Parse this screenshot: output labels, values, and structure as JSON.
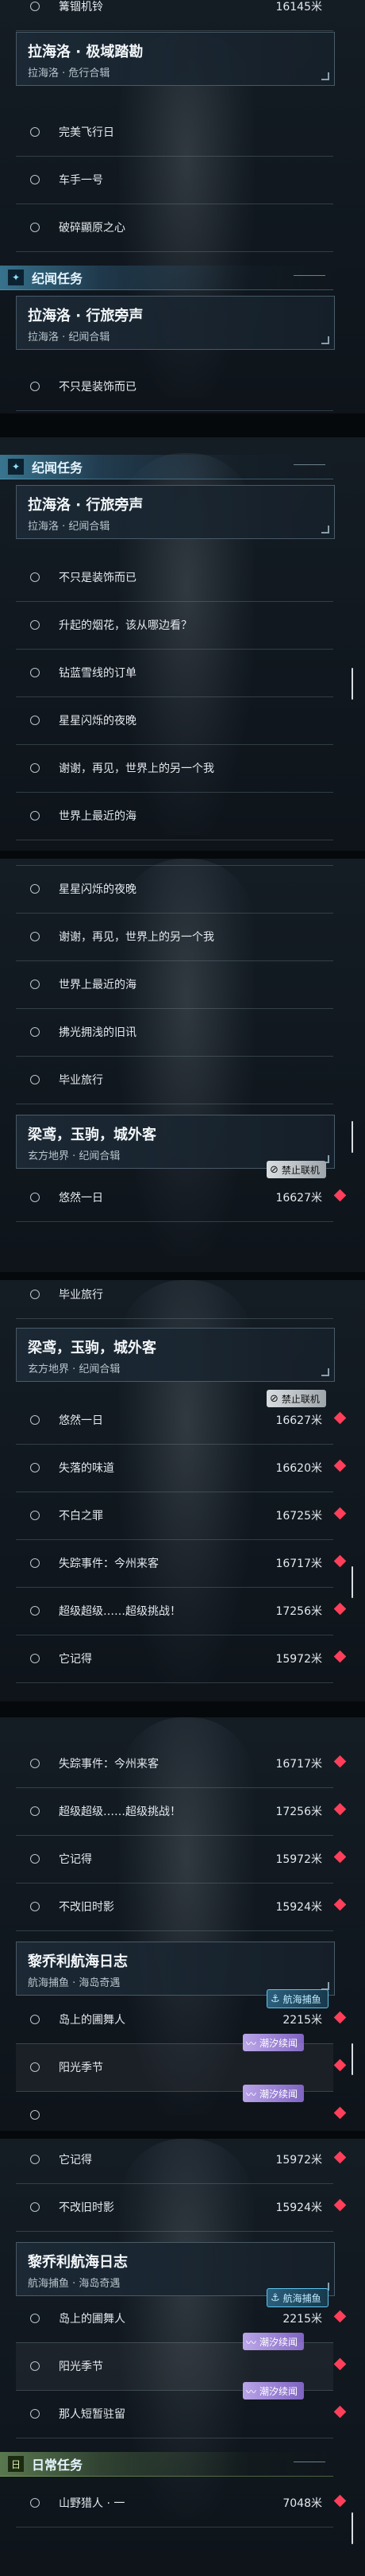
{
  "sections": {
    "jiwen": "纪闻任务",
    "daily": "日常任务"
  },
  "quests": {
    "lahailuo_jiyu": {
      "title": "拉海洛 · 极域踏勘",
      "subtitle": "拉海洛 · 危行合辑"
    },
    "lahailuo_xinglv": {
      "title": "拉海洛 · 行旅旁声",
      "subtitle": "拉海洛 · 纪闻合辑"
    },
    "liangniao": {
      "title": "梁鸢，玉驹，城外客",
      "subtitle": "玄方地界 · 纪闻合辑"
    },
    "liqiaoli": {
      "title": "黎乔利航海日志",
      "subtitle": "航海捕鱼 · 海岛奇遇"
    }
  },
  "items": {
    "huoji": "篝锢机铃",
    "wanmei": "完美飞行日",
    "cheshou": "车手一号",
    "posui": "破碎顯原之心",
    "bujin": "不只是装饰而已",
    "shengqi": "升起的烟花，该从哪边看？",
    "zuanlan": "钻蓝雪线的订单",
    "xingxing": "星星闪烁的夜晚",
    "xiexie": "谢谢，再见，世界上的另一个我",
    "shijie": "世界上最近的海",
    "fuguang": "拂光拥浅的旧讯",
    "biye": "毕业旅行",
    "youran": "悠然一日",
    "shiluo": "失落的味道",
    "buzhi": "不白之罪",
    "shizong": "失踪事件：今州来客",
    "chaoji": "超级超级……超级挑战！",
    "taji": "它记得",
    "buzai": "不改旧时影",
    "daoshang": "岛上的圃舞人",
    "yangguang": "阳光季节",
    "narenyi": "那人短暂驻留",
    "shanye": "山野猎人 · 一"
  },
  "distances": {
    "d16145": "16145米",
    "d16627": "16627米",
    "d16620": "16620米",
    "d16725": "16725米",
    "d16717": "16717米",
    "d17256": "17256米",
    "d15972": "15972米",
    "d15924": "15924米",
    "d2215": "2215米",
    "d7048": "7048米"
  },
  "badges": {
    "no_coop": "禁止联机",
    "fishing": "航海捕鱼",
    "tide": "潮汐续闻"
  },
  "colors": {
    "accent_cyan": "#57bee8",
    "marker_red": "#ff3f5a",
    "daily_green": "#96c878",
    "badge_purple": "#8e73cf"
  }
}
